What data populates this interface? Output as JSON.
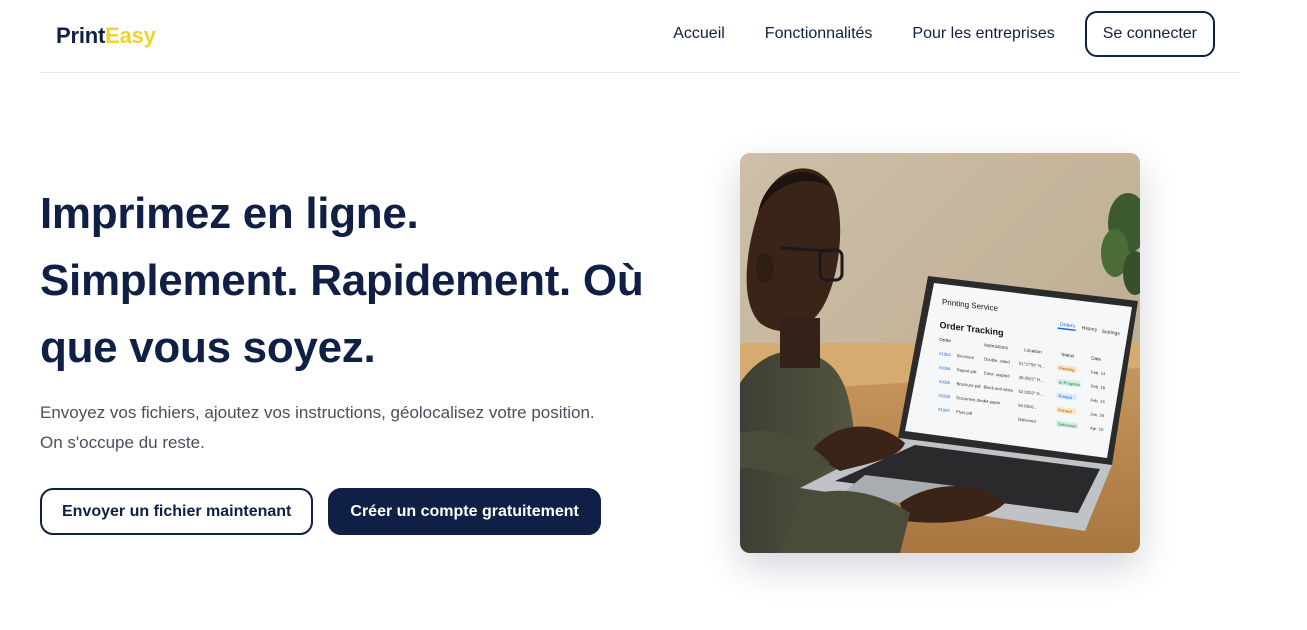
{
  "brand": {
    "part1": "Print",
    "part2": "Easy"
  },
  "nav": {
    "links": [
      "Accueil",
      "Fonctionnalités",
      "Pour les entreprises"
    ],
    "login_label": "Se connecter"
  },
  "hero": {
    "title": "Imprimez en ligne. Simplement. Rapidement. Où que vous soyez.",
    "subtitle_line1": "Envoyez vos fichiers, ajoutez vos instructions, géolocalisez votre position.",
    "subtitle_line2": "On s'occupe du reste.",
    "cta_primary": "Envoyer un fichier maintenant",
    "cta_secondary": "Créer un compte gratuitement"
  },
  "laptop_screen": {
    "app_title": "Printing Service",
    "tabs": [
      "Orders",
      "History",
      "Settings"
    ],
    "section_title": "Order Tracking",
    "columns": [
      "Order",
      "Instructions",
      "Location",
      "Status",
      "Date"
    ],
    "rows": [
      [
        "#1003",
        "Brochure",
        "Double, sided",
        "51°27'59\" N...",
        "Pending",
        "Feb. 14"
      ],
      [
        "#1004",
        "Report.pdf",
        "Color, stapled",
        "38.0522° N...",
        "In Progress",
        "Feb. 18"
      ],
      [
        "#1005",
        "Brochure.pdf",
        "Black and white",
        "52.0203° N...",
        "Printed",
        "Feb. 14"
      ],
      [
        "#1006",
        "Document.docx",
        "A4 paper",
        "50.0816...",
        "Printed",
        "Jan. 25"
      ],
      [
        "#1007",
        "Flyer.pdf",
        "",
        "Delivered",
        "Delivered",
        "Apr. 10"
      ]
    ]
  },
  "colors": {
    "navy": "#0f1f45",
    "brand_yellow": "#f0d32b",
    "body_text": "#4a4f5c"
  }
}
